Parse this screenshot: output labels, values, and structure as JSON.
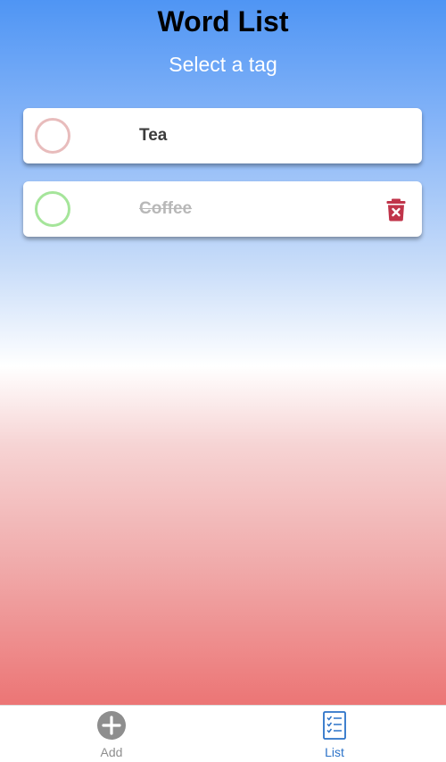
{
  "header": {
    "title": "Word List",
    "subtitle": "Select a tag"
  },
  "items": [
    {
      "word": "Tea",
      "completed": false,
      "circle_color": "#e8bcbc"
    },
    {
      "word": "Coffee",
      "completed": true,
      "circle_color": "#a5e59a"
    }
  ],
  "tabs": [
    {
      "label": "Add",
      "icon": "plus-circle-icon",
      "active": false,
      "color": "#8e8e8e"
    },
    {
      "label": "List",
      "icon": "checklist-icon",
      "active": true,
      "color": "#2b72c8"
    }
  ],
  "colors": {
    "gradient_top": "#4f95f4",
    "gradient_middle": "#ffffff",
    "gradient_bottom": "#ec7575",
    "trash": "#c0344a"
  }
}
